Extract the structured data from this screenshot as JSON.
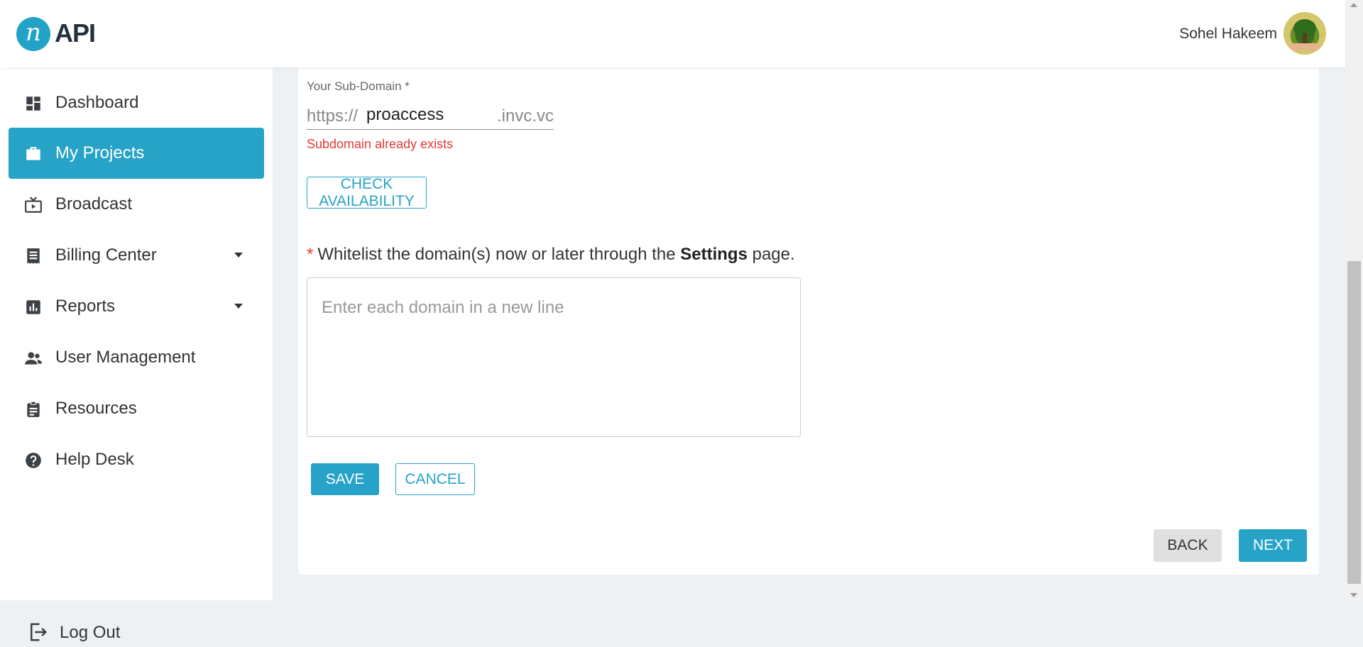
{
  "header": {
    "logo_mark": "n",
    "logo_text": "API",
    "user_name": "Sohel Hakeem"
  },
  "sidebar": {
    "items": [
      {
        "label": "Dashboard",
        "icon": "dashboard-icon"
      },
      {
        "label": "My Projects",
        "icon": "briefcase-icon",
        "active": true
      },
      {
        "label": "Broadcast",
        "icon": "tv-icon"
      },
      {
        "label": "Billing Center",
        "icon": "receipt-icon",
        "has_dropdown": true
      },
      {
        "label": "Reports",
        "icon": "bar-chart-icon",
        "has_dropdown": true
      },
      {
        "label": "User Management",
        "icon": "people-icon"
      },
      {
        "label": "Resources",
        "icon": "clipboard-icon"
      },
      {
        "label": "Help Desk",
        "icon": "help-icon"
      }
    ],
    "logout_label": "Log Out"
  },
  "form": {
    "subdomain_label": "Your Sub-Domain *",
    "subdomain_prefix": "https://",
    "subdomain_value": "proaccess",
    "subdomain_suffix": ".invc.vc",
    "subdomain_error": "Subdomain already exists",
    "check_availability_label": "CHECK AVAILABILITY",
    "whitelist_required_mark": "*",
    "whitelist_text_before": "Whitelist the domain(s) now or later through the",
    "whitelist_text_bold": "Settings",
    "whitelist_text_after": "page.",
    "domains_placeholder": "Enter each domain in a new line",
    "save_label": "SAVE",
    "cancel_label": "CANCEL"
  },
  "footer_actions": {
    "back_label": "BACK",
    "next_label": "NEXT"
  },
  "colors": {
    "accent": "#26a3c7",
    "error": "#e53935",
    "sidebar_active_bg": "#26a3c7"
  }
}
